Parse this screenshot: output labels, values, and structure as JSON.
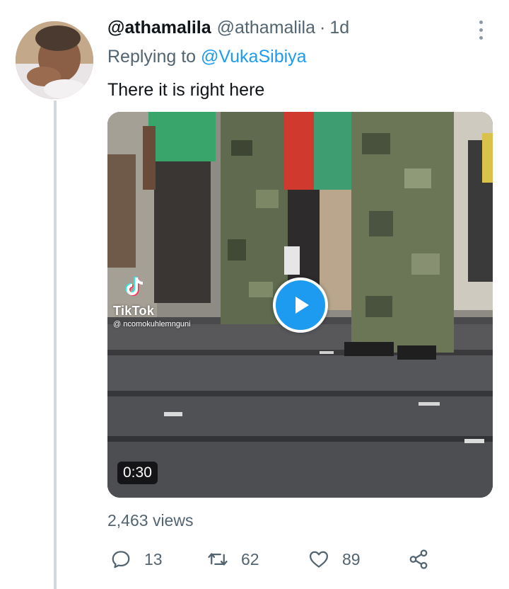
{
  "tweet": {
    "display_name": "@athamalila",
    "handle": "@athamalila",
    "separator": "·",
    "time": "1d",
    "replying_prefix": "Replying to",
    "replying_to": "@VukaSibiya",
    "text": "There it is right here"
  },
  "media": {
    "watermark_brand": "TikTok",
    "watermark_user": "@ ncomokuhlemnguni",
    "duration": "0:30"
  },
  "views": "2,463 views",
  "actions": {
    "replies": "13",
    "retweets": "62",
    "likes": "89"
  },
  "icons": {
    "more": "more-vertical-icon",
    "reply": "reply-icon",
    "retweet": "retweet-icon",
    "like": "heart-icon",
    "share": "share-icon",
    "play": "play-icon"
  },
  "colors": {
    "accent": "#1d9bf0",
    "secondary_text": "#536471",
    "thread_line": "#cfd9de"
  }
}
